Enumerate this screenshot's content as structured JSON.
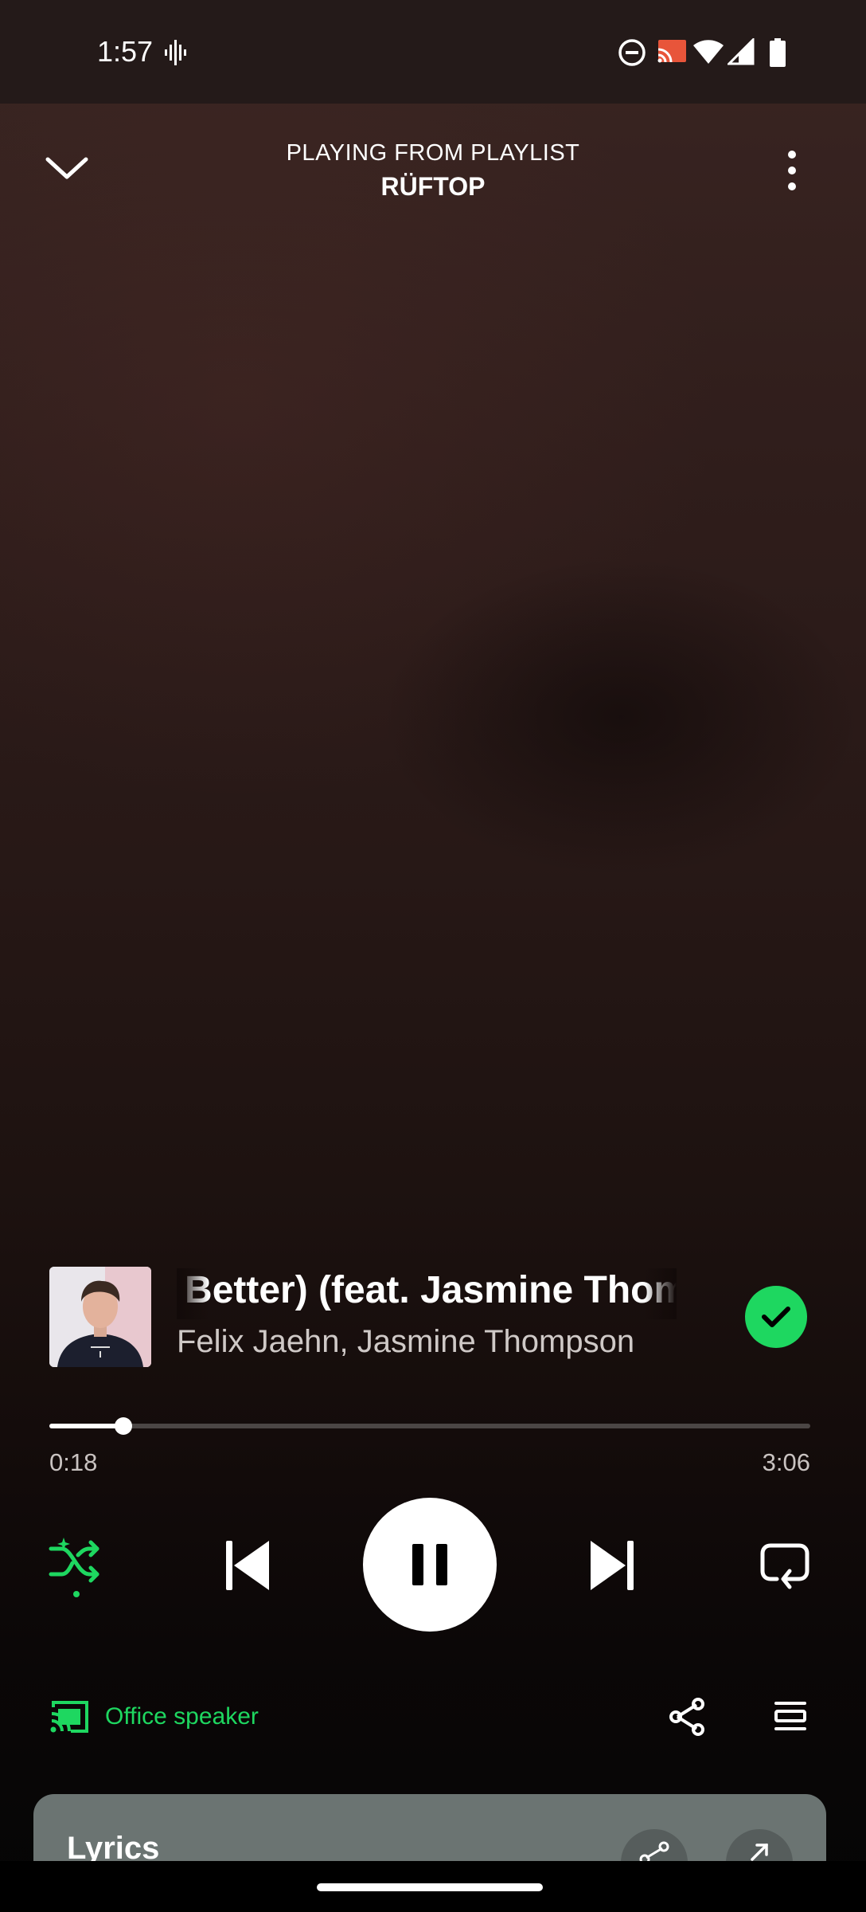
{
  "status_bar": {
    "time": "1:57"
  },
  "header": {
    "subtitle": "PLAYING FROM PLAYLIST",
    "title": "RÜFTOP"
  },
  "track": {
    "title": "e Better) (feat. Jasmine Thompson)",
    "artists": "Felix Jaehn, Jasmine Thompson",
    "saved": true
  },
  "playback": {
    "elapsed": "0:18",
    "duration": "3:06",
    "progress_fraction": 0.097,
    "state": "playing",
    "shuffle": true,
    "repeat": false
  },
  "device": {
    "name": "Office speaker"
  },
  "lyrics": {
    "title": "Lyrics"
  },
  "colors": {
    "accent": "#1ed760",
    "background_top": "#3a2522",
    "background_bottom": "#050505",
    "lyrics_card": "#6b7472"
  },
  "icons": {
    "collapse": "chevron-down-icon",
    "menu": "more-vertical-icon",
    "previous": "skip-previous-icon",
    "next": "skip-next-icon",
    "pause": "pause-icon",
    "shuffle": "shuffle-icon",
    "repeat": "repeat-icon",
    "cast": "cast-icon",
    "share": "share-icon",
    "queue": "queue-icon"
  }
}
